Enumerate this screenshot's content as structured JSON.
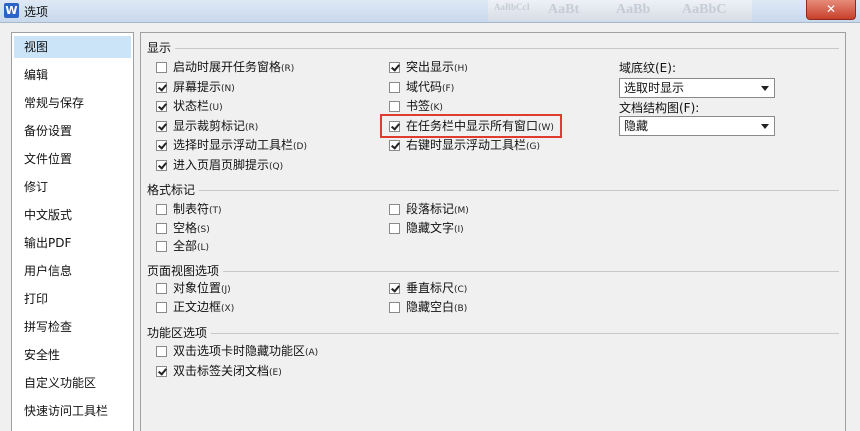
{
  "window": {
    "title": "选项",
    "app_icon": "W",
    "close_label": "✕"
  },
  "ribbon_ghost": [
    "AaBbCcI",
    "AaBt",
    "AaBb",
    "AaBbC"
  ],
  "sidebar": {
    "items": [
      {
        "label": "视图",
        "selected": true
      },
      {
        "label": "编辑"
      },
      {
        "label": "常规与保存"
      },
      {
        "label": "备份设置"
      },
      {
        "label": "文件位置"
      },
      {
        "label": "修订"
      },
      {
        "label": "中文版式"
      },
      {
        "label": "输出PDF"
      },
      {
        "label": "用户信息"
      },
      {
        "label": "打印"
      },
      {
        "label": "拼写检查"
      },
      {
        "label": "安全性"
      },
      {
        "label": "自定义功能区"
      },
      {
        "label": "快速访问工具栏"
      }
    ]
  },
  "display": {
    "title": "显示",
    "col1": [
      {
        "label": "启动时展开任务窗格",
        "key": "(R)",
        "checked": false
      },
      {
        "label": "屏幕提示",
        "key": "(N)",
        "checked": true
      },
      {
        "label": "状态栏",
        "key": "(U)",
        "checked": true
      },
      {
        "label": "显示裁剪标记",
        "key": "(R)",
        "checked": true
      },
      {
        "label": "选择时显示浮动工具栏",
        "key": "(D)",
        "checked": true
      },
      {
        "label": "进入页眉页脚提示",
        "key": "(Q)",
        "checked": true
      }
    ],
    "col2": [
      {
        "label": "突出显示",
        "key": "(H)",
        "checked": true
      },
      {
        "label": "域代码",
        "key": "(F)",
        "checked": false
      },
      {
        "label": "书签",
        "key": "(K)",
        "checked": false
      },
      {
        "label": "在任务栏中显示所有窗口",
        "key": "(W)",
        "checked": true
      },
      {
        "label": "右键时显示浮动工具栏",
        "key": "(G)",
        "checked": true
      }
    ],
    "field_shading": {
      "label": "域底纹(E):",
      "value": "选取时显示"
    },
    "doc_map": {
      "label": "文档结构图(F):",
      "value": "隐藏"
    }
  },
  "format_marks": {
    "title": "格式标记",
    "col1": [
      {
        "label": "制表符",
        "key": "(T)",
        "checked": false
      },
      {
        "label": "空格",
        "key": "(S)",
        "checked": false
      },
      {
        "label": "全部",
        "key": "(L)",
        "checked": false
      }
    ],
    "col2": [
      {
        "label": "段落标记",
        "key": "(M)",
        "checked": false
      },
      {
        "label": "隐藏文字",
        "key": "(I)",
        "checked": false
      }
    ]
  },
  "page_view": {
    "title": "页面视图选项",
    "col1": [
      {
        "label": "对象位置",
        "key": "(J)",
        "checked": false
      },
      {
        "label": "正文边框",
        "key": "(X)",
        "checked": false
      }
    ],
    "col2": [
      {
        "label": "垂直标尺",
        "key": "(C)",
        "checked": true
      },
      {
        "label": "隐藏空白",
        "key": "(B)",
        "checked": false
      }
    ]
  },
  "ribbon_options": {
    "title": "功能区选项",
    "col1": [
      {
        "label": "双击选项卡时隐藏功能区",
        "key": "(A)",
        "checked": false
      },
      {
        "label": "双击标签关闭文档",
        "key": "(E)",
        "checked": true
      }
    ]
  },
  "colors": {
    "selection": "#cce4f7",
    "highlight_border": "#e03c2e",
    "close_button": "#c7412c"
  }
}
